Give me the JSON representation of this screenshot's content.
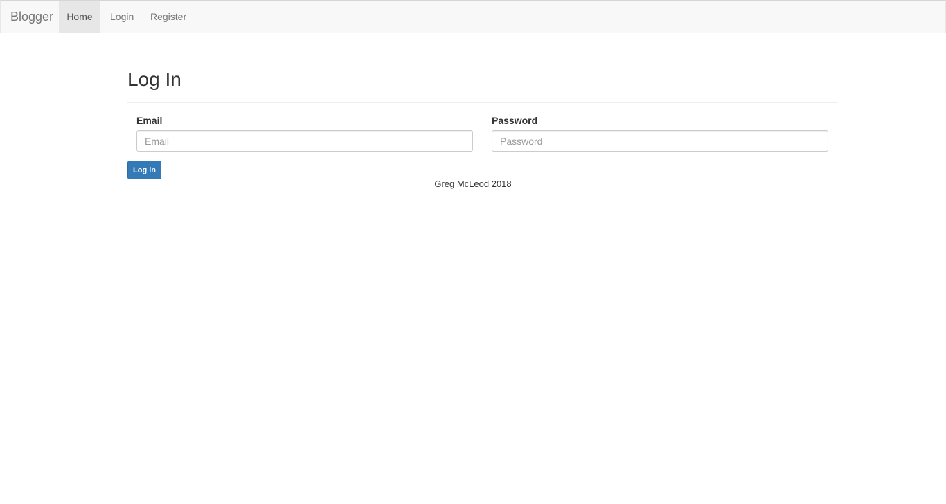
{
  "navbar": {
    "brand": "Blogger",
    "items": [
      {
        "label": "Home",
        "active": true
      },
      {
        "label": "Login",
        "active": false
      },
      {
        "label": "Register",
        "active": false
      }
    ]
  },
  "main": {
    "title": "Log In",
    "email": {
      "label": "Email",
      "placeholder": "Email",
      "value": ""
    },
    "password": {
      "label": "Password",
      "placeholder": "Password",
      "value": ""
    },
    "submit_label": "Log in"
  },
  "footer": {
    "text": "Greg McLeod 2018"
  },
  "colors": {
    "primary": "#337ab7",
    "navbar_bg": "#f8f8f8",
    "active_nav_bg": "#e7e7e7"
  }
}
